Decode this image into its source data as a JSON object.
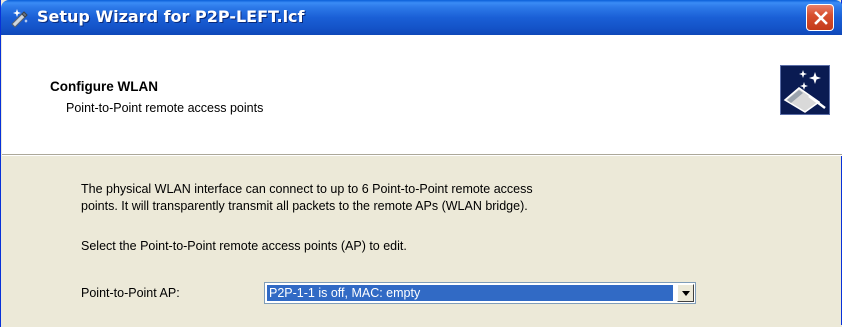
{
  "window": {
    "title": "Setup Wizard for P2P-LEFT.lcf",
    "icons": {
      "app": "wizard-wand-icon",
      "close": "close-icon"
    }
  },
  "header": {
    "title": "Configure WLAN",
    "subtitle": "Point-to-Point remote access points",
    "icon": "wizard-sparkle-icon"
  },
  "content": {
    "paragraph1_line1": "The physical WLAN interface can connect to up to 6 Point-to-Point remote access",
    "paragraph1_line2": "points. It will transparently transmit all packets to the remote APs (WLAN bridge).",
    "paragraph2": "Select the Point-to-Point remote access points (AP) to edit.",
    "ap_label": "Point-to-Point AP:",
    "ap_select_value": "P2P-1-1 is off, MAC: empty"
  },
  "colors": {
    "titlebar": "#1a5fd6",
    "close_button": "#d8502f",
    "selection": "#316ac5",
    "dialog_background": "#ece9d8"
  }
}
